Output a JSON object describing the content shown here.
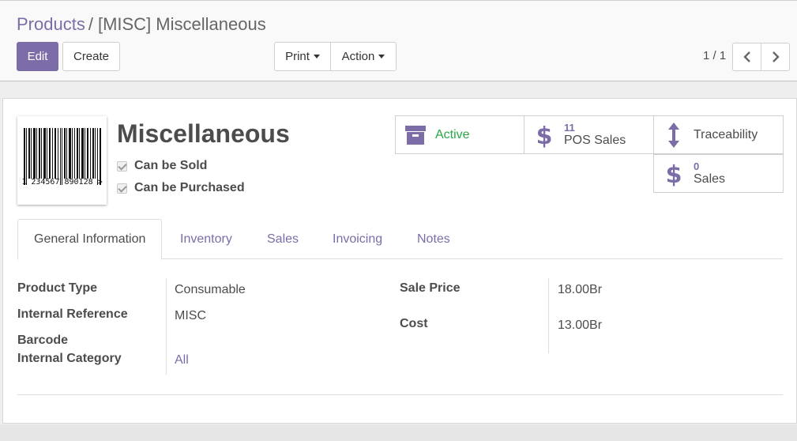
{
  "breadcrumb": {
    "parent": "Products",
    "separator": "/",
    "current": "[MISC] Miscellaneous"
  },
  "toolbar": {
    "edit_label": "Edit",
    "create_label": "Create",
    "print_label": "Print",
    "action_label": "Action"
  },
  "pager": {
    "value": "1 / 1",
    "prev_icon": "chevron-left-icon",
    "next_icon": "chevron-right-icon"
  },
  "product": {
    "name": "Miscellaneous",
    "barcode_text": "1 234567 890128 >",
    "can_be_sold_label": "Can be Sold",
    "can_be_sold": true,
    "can_be_purchased_label": "Can be Purchased",
    "can_be_purchased": true
  },
  "smart_buttons": {
    "active": {
      "label": "Active",
      "icon": "archive-icon",
      "color": "#28a745"
    },
    "pos_sales": {
      "count": "11",
      "label": "POS Sales",
      "icon": "dollar-icon"
    },
    "traceability": {
      "label": "Traceability",
      "icon": "arrows-v-icon"
    },
    "sales": {
      "count": "0",
      "label": "Sales",
      "icon": "dollar-icon"
    }
  },
  "tabs": [
    {
      "label": "General Information",
      "active": true
    },
    {
      "label": "Inventory",
      "active": false
    },
    {
      "label": "Sales",
      "active": false
    },
    {
      "label": "Invoicing",
      "active": false
    },
    {
      "label": "Notes",
      "active": false
    }
  ],
  "general_info": {
    "product_type_label": "Product Type",
    "product_type_value": "Consumable",
    "internal_reference_label": "Internal Reference",
    "internal_reference_value": "MISC",
    "barcode_label": "Barcode",
    "barcode_value": "",
    "internal_category_label": "Internal Category",
    "internal_category_value": "All",
    "sale_price_label": "Sale Price",
    "sale_price_value": "18.00Br",
    "cost_label": "Cost",
    "cost_value": "13.00Br"
  },
  "colors": {
    "primary": "#7c6da8",
    "active_green": "#28a745"
  }
}
